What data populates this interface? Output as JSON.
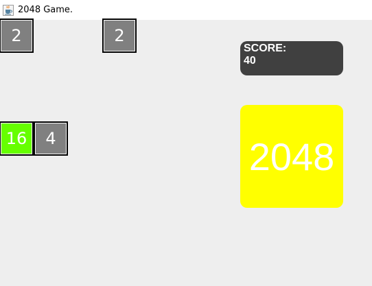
{
  "window": {
    "title": "2048 Game.",
    "icon": "java-cup-icon"
  },
  "board": {
    "tiles": [
      {
        "row": 0,
        "col": 0,
        "value": "2",
        "color": "#808080"
      },
      {
        "row": 0,
        "col": 3,
        "value": "2",
        "color": "#808080"
      },
      {
        "row": 3,
        "col": 0,
        "value": "16",
        "color": "#66ff00"
      },
      {
        "row": 3,
        "col": 1,
        "value": "4",
        "color": "#808080"
      }
    ]
  },
  "score": {
    "label": "SCORE:",
    "value": "40",
    "color": "#404040"
  },
  "target": {
    "value": "2048",
    "color": "#ffff00"
  }
}
